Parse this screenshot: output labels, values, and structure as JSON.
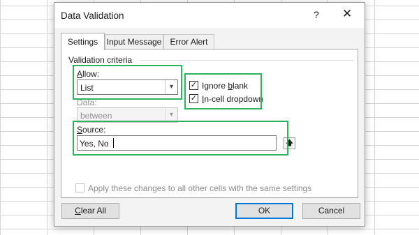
{
  "dialog": {
    "title": "Data Validation",
    "help_label": "?",
    "close_label": "✕"
  },
  "tabs": [
    {
      "label": "Settings"
    },
    {
      "label": "Input Message"
    },
    {
      "label": "Error Alert"
    }
  ],
  "criteria": {
    "group_label": "Validation criteria",
    "allow": {
      "label_u": "A",
      "label_rest": "llow:",
      "value": "List"
    },
    "data": {
      "label": "Data:",
      "value": "between"
    },
    "ignore_blank": {
      "label_pre": "Ignore ",
      "label_u": "b",
      "label_rest": "lank",
      "checked": true
    },
    "in_cell_dropdown": {
      "label_u": "I",
      "label_rest": "n-cell dropdown",
      "checked": true
    },
    "source": {
      "label_u": "S",
      "label_rest": "ource:",
      "value": "Yes, No",
      "button_icon": "collapse-dialog-icon"
    }
  },
  "apply_all": {
    "label": "Apply these changes to all other cells with the same settings",
    "checked": false
  },
  "buttons": {
    "clear_u": "C",
    "clear_rest": "lear All",
    "ok": "OK",
    "cancel": "Cancel"
  },
  "colors": {
    "highlight": "#2db35d",
    "ok_border": "#0078d7"
  }
}
